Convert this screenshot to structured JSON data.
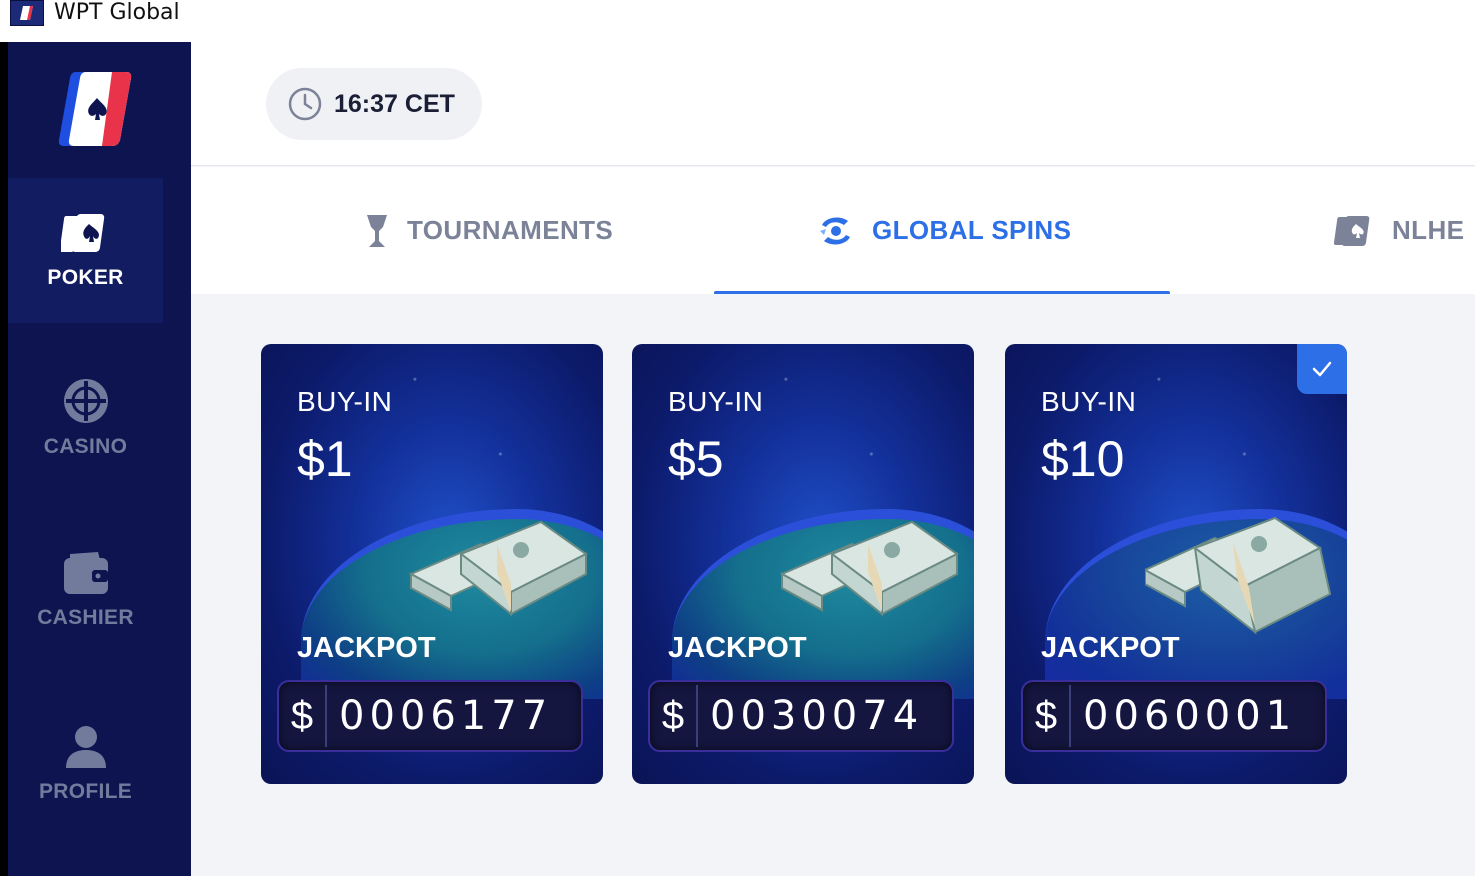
{
  "window": {
    "title": "WPT Global"
  },
  "sidebar": {
    "items": [
      {
        "label": "POKER",
        "icon": "poker-cards-icon",
        "active": true
      },
      {
        "label": "CASINO",
        "icon": "casino-chip-icon",
        "active": false
      },
      {
        "label": "CASHIER",
        "icon": "wallet-icon",
        "active": false
      },
      {
        "label": "PROFILE",
        "icon": "user-icon",
        "active": false
      }
    ]
  },
  "header": {
    "time": "16:37 CET"
  },
  "tabs": [
    {
      "label": "TOURNAMENTS",
      "icon": "trophy-icon",
      "active": false
    },
    {
      "label": "GLOBAL SPINS",
      "icon": "spin-icon",
      "active": true
    },
    {
      "label": "NLHE",
      "icon": "poker-cards-icon",
      "active": false
    }
  ],
  "cards": [
    {
      "buyin_label": "BUY-IN",
      "buyin": "$1",
      "jackpot_label": "JACKPOT",
      "currency": "$",
      "jackpot": "0006177",
      "selected": false
    },
    {
      "buyin_label": "BUY-IN",
      "buyin": "$5",
      "jackpot_label": "JACKPOT",
      "currency": "$",
      "jackpot": "0030074",
      "selected": false
    },
    {
      "buyin_label": "BUY-IN",
      "buyin": "$10",
      "jackpot_label": "JACKPOT",
      "currency": "$",
      "jackpot": "0060001",
      "selected": true
    }
  ],
  "colors": {
    "sidebar": "#0d1450",
    "accent": "#2d6fe6",
    "brand_red": "#e8334a"
  }
}
